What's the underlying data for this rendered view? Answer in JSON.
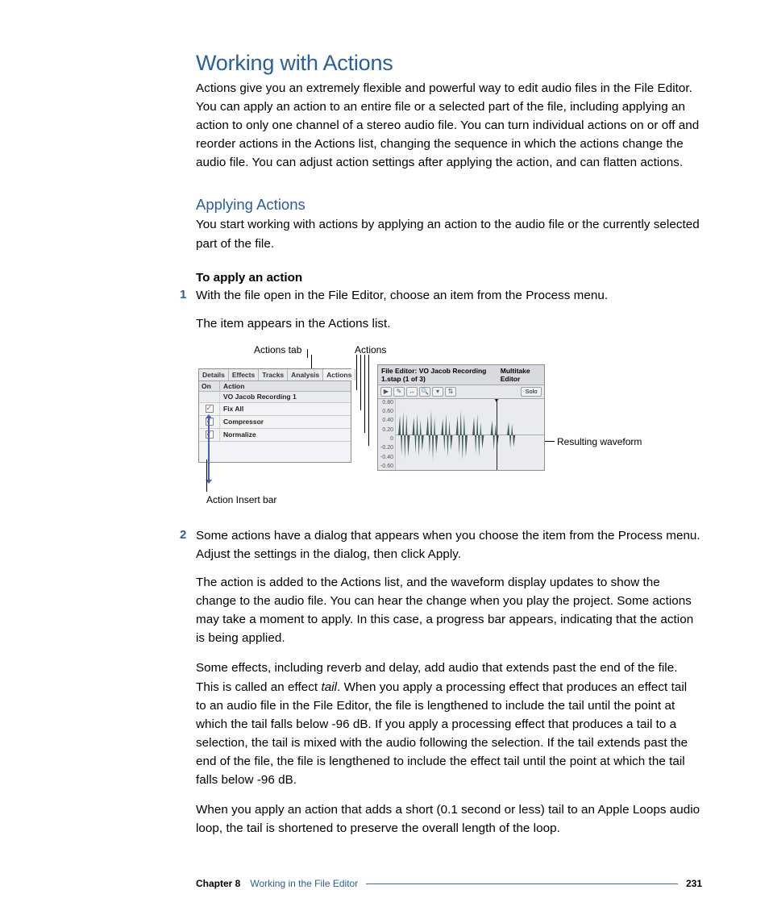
{
  "heading1": "Working with Actions",
  "intro": "Actions give you an extremely flexible and powerful way to edit audio files in the File Editor. You can apply an action to an entire file or a selected part of the file, including applying an action to only one channel of a stereo audio file. You can turn individual actions on or off and reorder actions in the Actions list, changing the sequence in which the actions change the audio file. You can adjust action settings after applying the action, and can flatten actions.",
  "heading2": "Applying Actions",
  "sub_intro": "You start working with actions by applying an action to the audio file or the currently selected part of the file.",
  "task_head": "To apply an action",
  "step1_num": "1",
  "step1": "With the file open in the File Editor, choose an item from the Process menu.",
  "step1_result": "The item appears in the Actions list.",
  "callout_actions_tab": "Actions tab",
  "callout_actions": "Actions",
  "callout_insert_bar": "Action Insert bar",
  "callout_resulting": "Resulting waveform",
  "panel": {
    "tabs": [
      "Details",
      "Effects",
      "Tracks",
      "Analysis",
      "Actions"
    ],
    "head_on": "On",
    "head_action": "Action",
    "rows": [
      {
        "label": "VO Jacob Recording 1"
      },
      {
        "label": "Fix All"
      },
      {
        "label": "Compressor"
      },
      {
        "label": "Normalize"
      }
    ]
  },
  "wave": {
    "title": "File Editor: VO Jacob Recording 1.stap (1 of 3)",
    "multitake": "Multitake Editor",
    "solo": "Solo",
    "scale": [
      "0.80",
      "0.60",
      "0.40",
      "0.20",
      "0",
      "-0.20",
      "-0.40",
      "-0.60"
    ]
  },
  "step2_num": "2",
  "step2": "Some actions have a dialog that appears when you choose the item from the Process menu. Adjust the settings in the dialog, then click Apply.",
  "para_added": "The action is added to the Actions list, and the waveform display updates to show the change to the audio file. You can hear the change when you play the project. Some actions may take a moment to apply. In this case, a progress bar appears, indicating that the action is being applied.",
  "para_tail_pre": "Some effects, including reverb and delay, add audio that extends past the end of the file. This is called an effect ",
  "para_tail_italic": "tail",
  "para_tail_post": ". When you apply a processing effect that produces an effect tail to an audio file in the File Editor, the file is lengthened to include the tail until the point at which the tail falls below -96 dB. If you apply a processing effect that produces a tail to a selection, the tail is mixed with the audio following the selection. If the tail extends past the end of the file, the file is lengthened to include the effect tail until the point at which the tail falls below -96 dB.",
  "para_loops": "When you apply an action that adds a short (0.1 second or less) tail to an Apple Loops audio loop, the tail is shortened to preserve the overall length of the loop.",
  "footer": {
    "chapter": "Chapter 8",
    "title": "Working in the File Editor",
    "page": "231"
  }
}
